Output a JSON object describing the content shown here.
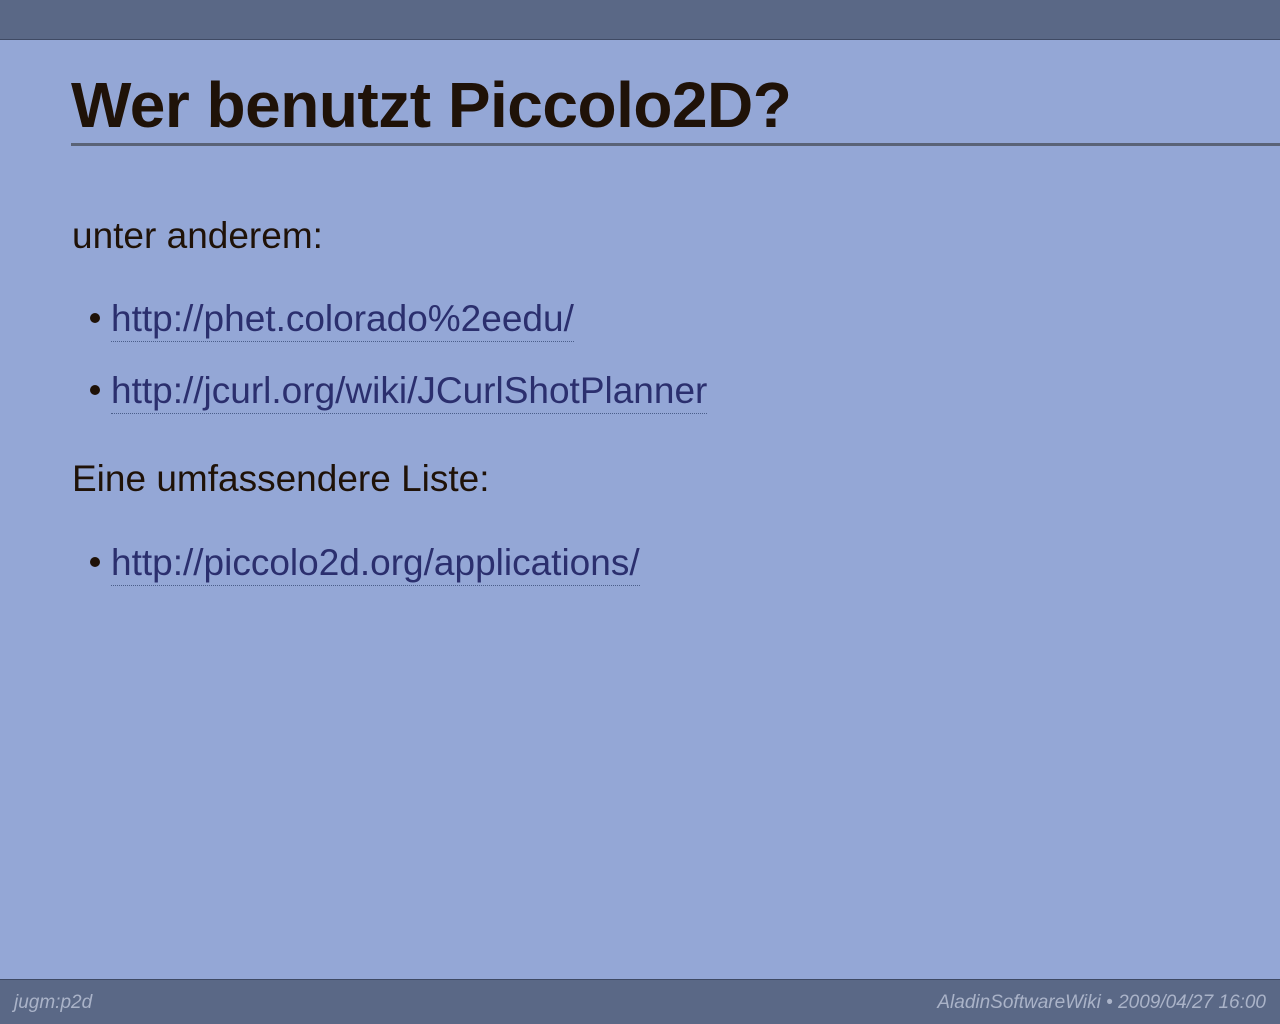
{
  "slide": {
    "title": "Wer benutzt Piccolo2D?",
    "intro": "unter anderem:",
    "links_1": [
      "http://phet.colorado%2eedu/",
      "http://jcurl.org/wiki/JCurlShotPlanner"
    ],
    "section_2": "Eine umfassendere Liste:",
    "links_2": [
      "http://piccolo2d.org/applications/"
    ]
  },
  "footer": {
    "left": "jugm:p2d",
    "right": "AladinSoftwareWiki • 2009/04/27 16:00"
  },
  "colors": {
    "background": "#94a7d6",
    "bar": "#5a6886",
    "text": "#1f1208",
    "link": "#2b2f6e"
  }
}
